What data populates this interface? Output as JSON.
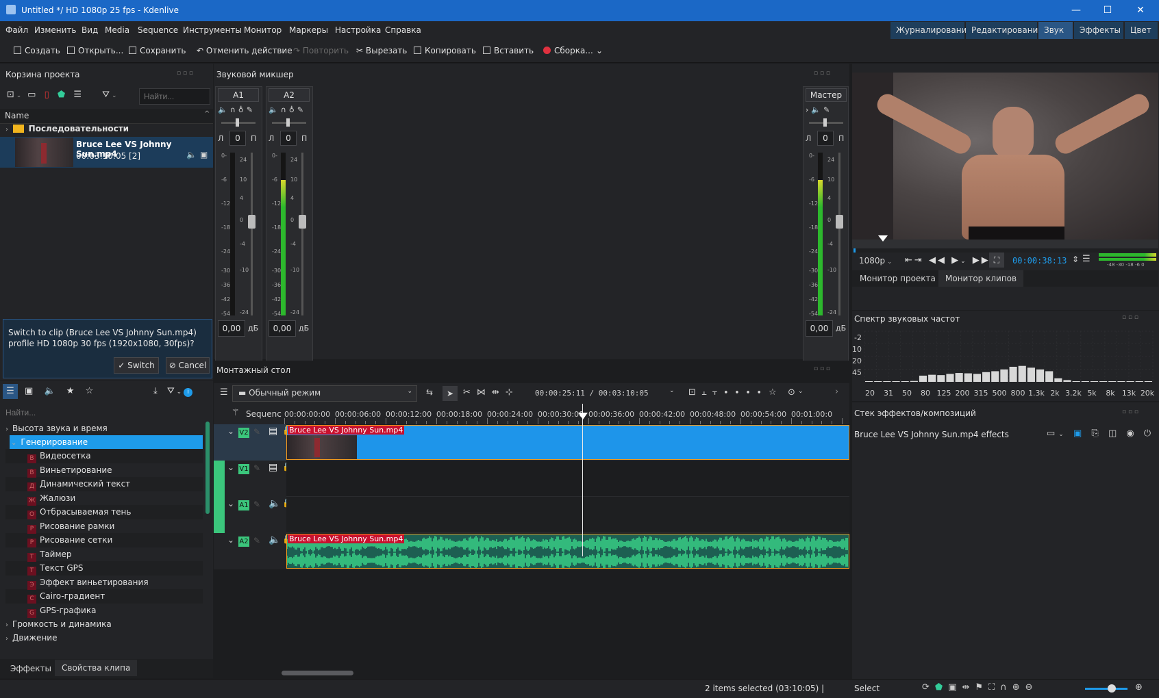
{
  "window": {
    "title": "Untitled */ HD 1080p 25 fps - Kdenlive",
    "controls": [
      "—",
      "☐",
      "✕"
    ]
  },
  "menu": [
    "Файл",
    "Изменить",
    "Вид",
    "Media",
    "Sequence",
    "Инструменты",
    "Монитор",
    "Маркеры",
    "Настройка",
    "Справка"
  ],
  "layouts": [
    "Журналирование",
    "Редактирование",
    "Звук",
    "Эффекты",
    "Цвет"
  ],
  "toolbar": {
    "create": "Создать",
    "open": "Открыть...",
    "save": "Сохранить",
    "undo": "Отменить действие",
    "redo": "Повторить",
    "cut": "Вырезать",
    "copy": "Копировать",
    "paste": "Вставить",
    "render": "Сборка..."
  },
  "project_bin": {
    "title": "Корзина проекта",
    "search_placeholder": "Найти...",
    "column": "Name",
    "folder": "Последовательности",
    "clip_name": "Bruce Lee VS Johnny Sun.mp4",
    "clip_duration": "00:03:10:05 [2]",
    "notice": "Switch to clip (Bruce Lee VS Johnny Sun.mp4) profile HD 1080p 30 fps (1920x1080, 30fps)?",
    "switch": "Switch",
    "cancel": "Cancel"
  },
  "mixer": {
    "title": "Звуковой микшер",
    "channels": [
      {
        "name": "A1",
        "left": "Л",
        "pan": "0",
        "right": "П",
        "gain": "0,00",
        "unit": "дБ",
        "level": 0
      },
      {
        "name": "A2",
        "left": "Л",
        "pan": "0",
        "right": "П",
        "gain": "0,00",
        "unit": "дБ",
        "level": 0.83
      }
    ],
    "master": {
      "name": "Мастер",
      "left": "Л",
      "pan": "0",
      "right": "П",
      "gain": "0,00",
      "unit": "дБ",
      "level": 0.83
    },
    "db_scale": [
      "0-",
      "-6",
      "-12",
      "-18",
      "-24",
      "-30",
      "-36",
      "-42",
      "-54"
    ],
    "fader_scale": [
      "24",
      "10",
      "4",
      "0",
      "-4",
      "-10",
      "-24"
    ]
  },
  "effects": {
    "search_placeholder": "Найти...",
    "categories": [
      {
        "label": "Высота звука и время",
        "expanded": false
      },
      {
        "label": "Генерирование",
        "expanded": true,
        "selected": true
      }
    ],
    "items": [
      {
        "badge": "В",
        "label": "Видеосетка"
      },
      {
        "badge": "В",
        "label": "Виньетирование"
      },
      {
        "badge": "Д",
        "label": "Динамический текст"
      },
      {
        "badge": "Ж",
        "label": "Жалюзи"
      },
      {
        "badge": "О",
        "label": "Отбрасываемая тень"
      },
      {
        "badge": "Р",
        "label": "Рисование рамки"
      },
      {
        "badge": "Р",
        "label": "Рисование сетки"
      },
      {
        "badge": "Т",
        "label": "Таймер"
      },
      {
        "badge": "Т",
        "label": "Текст GPS"
      },
      {
        "badge": "Э",
        "label": "Эффект виньетирования"
      },
      {
        "badge": "C",
        "label": "Cairo-градиент"
      },
      {
        "badge": "G",
        "label": "GPS-графика"
      }
    ],
    "more_categories": [
      "Громкость и динамика",
      "Движение"
    ],
    "bottom_tabs": [
      "Эффекты",
      "Свойства клипа"
    ]
  },
  "monitor": {
    "resolution": "1080p",
    "timecode": "00:00:38:13",
    "meter_labels": "-48 -30 -18 -6 0",
    "playhead": 0.1,
    "tabs": [
      "Монитор проекта",
      "Монитор клипов"
    ]
  },
  "spectrum": {
    "title": "Спектр звуковых частот",
    "y_labels": [
      "-2",
      "-10",
      "-20",
      "-45"
    ],
    "x_labels": [
      "20",
      "31",
      "50",
      "80",
      "125",
      "200",
      "315",
      "500",
      "800",
      "1.3k",
      "2k",
      "3.2k",
      "5k",
      "8k",
      "13k",
      "20k"
    ],
    "bars": [
      0,
      0,
      0,
      0,
      0,
      0.05,
      0.35,
      0.4,
      0.38,
      0.45,
      0.5,
      0.48,
      0.45,
      0.55,
      0.6,
      0.7,
      0.85,
      0.9,
      0.8,
      0.7,
      0.6,
      0.2,
      0.1,
      0,
      0,
      0,
      0,
      0,
      0,
      0,
      0,
      0
    ]
  },
  "effect_stack": {
    "title": "Стек эффектов/композиций",
    "label": "Bruce Lee VS Johnny Sun.mp4 effects"
  },
  "timeline": {
    "title": "Монтажный стол",
    "mode": "Обычный режим",
    "position": "00:00:25:11",
    "separator": "/",
    "duration": "00:03:10:05",
    "sequence_label": "Sequence",
    "ruler": [
      "00:00:00:00",
      "00:00:06:00",
      "00:00:12:00",
      "00:00:18:00",
      "00:00:24:00",
      "00:00:30:00",
      "00:00:36:00",
      "00:00:42:00",
      "00:00:48:00",
      "00:00:54:00",
      "00:01:00:0"
    ],
    "playhead_time": "00:00:38:13",
    "tracks": [
      {
        "name": "V2",
        "type": "video",
        "clip": "Bruce Lee VS Johnny Sun.mp4"
      },
      {
        "name": "V1",
        "type": "video",
        "clip": ""
      },
      {
        "name": "A1",
        "type": "audio",
        "clip": ""
      },
      {
        "name": "A2",
        "type": "audio",
        "clip": "Bruce Lee VS Johnny Sun.mp4"
      }
    ]
  },
  "status": {
    "selection": "2 items selected (03:10:05) |",
    "tool": "Select"
  },
  "colors": {
    "accent": "#1e9bea",
    "clip_video": "#1e95ea",
    "clip_audio": "#1d5f52",
    "waveform": "#3bd88a",
    "track_active": "#3bc67c",
    "meter_green": "#2db82d"
  }
}
